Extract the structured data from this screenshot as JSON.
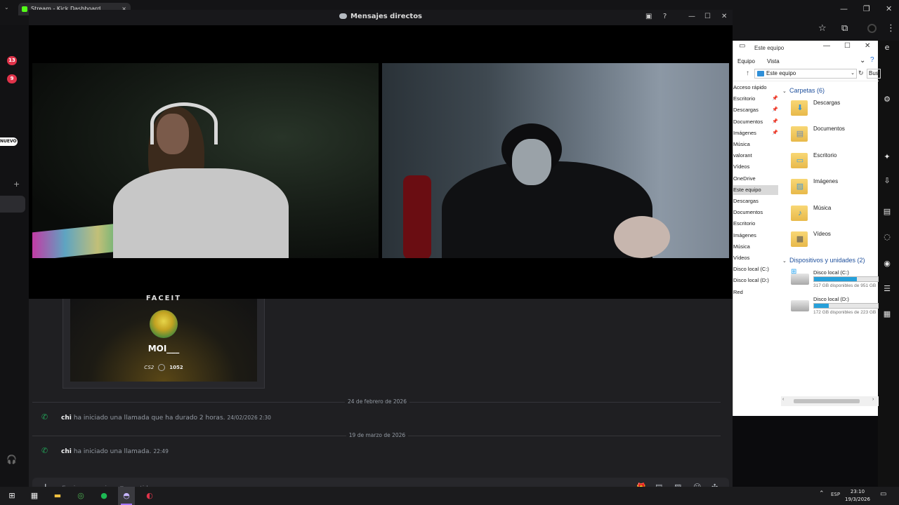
{
  "browser": {
    "tab_title": "Stream - Kick Dashboard",
    "tab_close": "×"
  },
  "left_strip": {
    "badge_1": "13",
    "badge_2": "9",
    "new_label": "NUEVO"
  },
  "explorer": {
    "title": "Este equipo",
    "ribbon": [
      "Equipo",
      "Vista"
    ],
    "address": "Este equipo",
    "search_placeholder": "Bus",
    "nav_items": [
      {
        "label": "Acceso rápido",
        "pinned": false
      },
      {
        "label": "Escritorio",
        "pinned": true
      },
      {
        "label": "Descargas",
        "pinned": true
      },
      {
        "label": "Documentos",
        "pinned": true
      },
      {
        "label": "Imágenes",
        "pinned": true
      },
      {
        "label": "Música",
        "pinned": false
      },
      {
        "label": "valorant",
        "pinned": false
      },
      {
        "label": "Vídeos",
        "pinned": false
      },
      {
        "label": "OneDrive",
        "pinned": false
      },
      {
        "label": "Este equipo",
        "pinned": false,
        "selected": true
      },
      {
        "label": "Descargas",
        "pinned": false
      },
      {
        "label": "Documentos",
        "pinned": false
      },
      {
        "label": "Escritorio",
        "pinned": false
      },
      {
        "label": "Imágenes",
        "pinned": false
      },
      {
        "label": "Música",
        "pinned": false
      },
      {
        "label": "Vídeos",
        "pinned": false
      },
      {
        "label": "Disco local (C:)",
        "pinned": false
      },
      {
        "label": "Disco local (D:)",
        "pinned": false
      },
      {
        "label": "Red",
        "pinned": false
      }
    ],
    "folders_header": "Carpetas (6)",
    "folders": [
      {
        "name": "Descargas",
        "icon": "download-arrow-icon"
      },
      {
        "name": "Documentos",
        "icon": "document-icon"
      },
      {
        "name": "Escritorio",
        "icon": "desktop-icon"
      },
      {
        "name": "Imágenes",
        "icon": "pictures-icon"
      },
      {
        "name": "Música",
        "icon": "music-note-icon"
      },
      {
        "name": "Vídeos",
        "icon": "film-icon"
      }
    ],
    "devices_header": "Dispositivos y unidades (2)",
    "drives": [
      {
        "name": "Disco local (C:)",
        "free": "317 GB disponibles de 951 GB",
        "used_fraction": 0.67
      },
      {
        "name": "Disco local (D:)",
        "free": "172 GB disponibles de 223 GB",
        "used_fraction": 0.23
      }
    ]
  },
  "discord": {
    "title": "Mensajes directos",
    "card": {
      "top_text": "FACEIT",
      "name": "MOI___",
      "stat_label": "CS2",
      "elo": "1052"
    },
    "messages": [
      {
        "date": "24 de febrero de 2026",
        "user": "chi",
        "text": "ha iniciado una llamada que ha durado 2 horas.",
        "time": "24/02/2026 2:30"
      },
      {
        "date": "19 de marzo de 2026",
        "user": "chi",
        "text": "ha iniciado una llamada.",
        "time": "22:49"
      }
    ],
    "composer_placeholder": "Enviar mensaje a @saanti.la"
  },
  "taskbar": {
    "lang": "ESP",
    "time": "23:10",
    "date": "19/3/2026",
    "active_accent": "#a374ff"
  }
}
